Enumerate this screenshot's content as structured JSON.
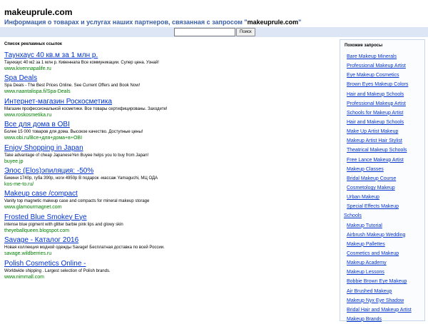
{
  "header": {
    "title": "makeuprule.com",
    "subtitle_prefix": "Информация о товарах и услугах наших партнеров, связанная с запросом \"",
    "subtitle_query": "makeuprule.com",
    "subtitle_suffix": "\""
  },
  "search": {
    "value": "",
    "button_label": "Поиск"
  },
  "ads": {
    "heading": "Список рекламных ссылок",
    "items": [
      {
        "title": "Таунхаус 40 кв.м за 1 млн р.",
        "desc": "Таунхаус 40 м2 за 1 млн р. Кивеннапа Все коммуникации. Супер цена. Узнай!",
        "url": "www.kivennapalife.ru"
      },
      {
        "title": "Spa Deals",
        "desc": "Spa Deals - The Best Prices Online. See Current Offers and Book Now!",
        "url": "www.naantalispa.fi/Spa-Deals"
      },
      {
        "title": "Интернет-магазин Роскосметика",
        "desc": "Магазин профессиональной косметики. Все товары сертифицированы. Заходите!",
        "url": "www.roskosmetika.ru"
      },
      {
        "title": "Все для дома в OBI",
        "desc": "Более 15 000 товаров для дома. Высокое качество. Доступные цены!",
        "url": "www.obi.ru/Все+для+дома+в+OBI"
      },
      {
        "title": "Enjoy Shopping in Japan",
        "desc": "Take advantage of cheap JapaneseYen Buyee helps you to buy from Japan!",
        "url": "buyee.jp"
      },
      {
        "title": "Элос (Elos)эпиляция: -50%",
        "desc": "Бикини 1740р, губа 390р, ноги 4950р В подарок -массаж Yamaguchi, МЦ ОДА",
        "url": "kos-me-to.ru/"
      },
      {
        "title": "Makeup case /compact",
        "desc": "Vanity top magnetic makeup case and compacts for mineral makeup storage",
        "url": "www.glamourmagnet.com"
      },
      {
        "title": "Frosted Blue Smokey Eye",
        "desc": "intense blue pigment with glitter barbie pink lips and glowy skin",
        "url": "theyeballqueen.blogspot.com"
      },
      {
        "title": "Savage - Каталог 2016",
        "desc": "Новая коллекция модной одежды Savage! Бесплатная доставка по всей России.",
        "url": "savage.wildberries.ru"
      },
      {
        "title": "Polish Cosmetics Online -",
        "desc": "Worldwide shipping . Largest selection of Polish brands.",
        "url": "www.nimmall.com"
      }
    ]
  },
  "related": {
    "heading": "Похожие запросы",
    "items": [
      {
        "label": "Bare Makeup Minerals",
        "link": true
      },
      {
        "label": "Professional Makeup Artist",
        "link": true
      },
      {
        "label": "Eye Makeup Cosmetics",
        "link": true
      },
      {
        "label": "Brown Eyes Makeup Colors",
        "link": true
      },
      {
        "label": "Hair and Makeup Schools",
        "link": true
      },
      {
        "label": "Professional Makeup Artist",
        "link": true
      },
      {
        "label": "Schools for Makeup Artist",
        "link": true
      },
      {
        "label": "Hair and Makeup Schools",
        "link": true
      },
      {
        "label": "Make Up Artist Makeup",
        "link": true
      },
      {
        "label": "Makeup Artist Hair Stylist",
        "link": true
      },
      {
        "label": "Theatrical Makeup Schools",
        "link": true
      },
      {
        "label": "Free Lance Makeup Artist",
        "link": true
      },
      {
        "label": "Makeup Classes",
        "link": true
      },
      {
        "label": "Bridal Makeup Course",
        "link": true
      },
      {
        "label": "Cosmetology Makeup",
        "link": true
      },
      {
        "label": "Urban Makeup",
        "link": true
      },
      {
        "label": "Special Effects Makeup",
        "link": true
      },
      {
        "label": "Schools",
        "link": true,
        "outdent": true
      },
      {
        "label": "Makeup Tutorial",
        "link": true
      },
      {
        "label": "Airbrush Makeup Wedding",
        "link": true
      },
      {
        "label": "Makeup Pallettes",
        "link": true
      },
      {
        "label": "Cosmetics and Makeup",
        "link": true
      },
      {
        "label": "Makeup Academy",
        "link": true
      },
      {
        "label": "Makeup Lessons",
        "link": true
      },
      {
        "label": "Bobbie Brown Eye Makeup",
        "link": true
      },
      {
        "label": "Air Brushed Makeup",
        "link": true
      },
      {
        "label": "Makeup Nyx Eye Shadow",
        "link": true
      },
      {
        "label": "Bridal Hair and Makeup Artist",
        "link": true
      },
      {
        "label": "Makeup Brands",
        "link": true
      }
    ]
  }
}
